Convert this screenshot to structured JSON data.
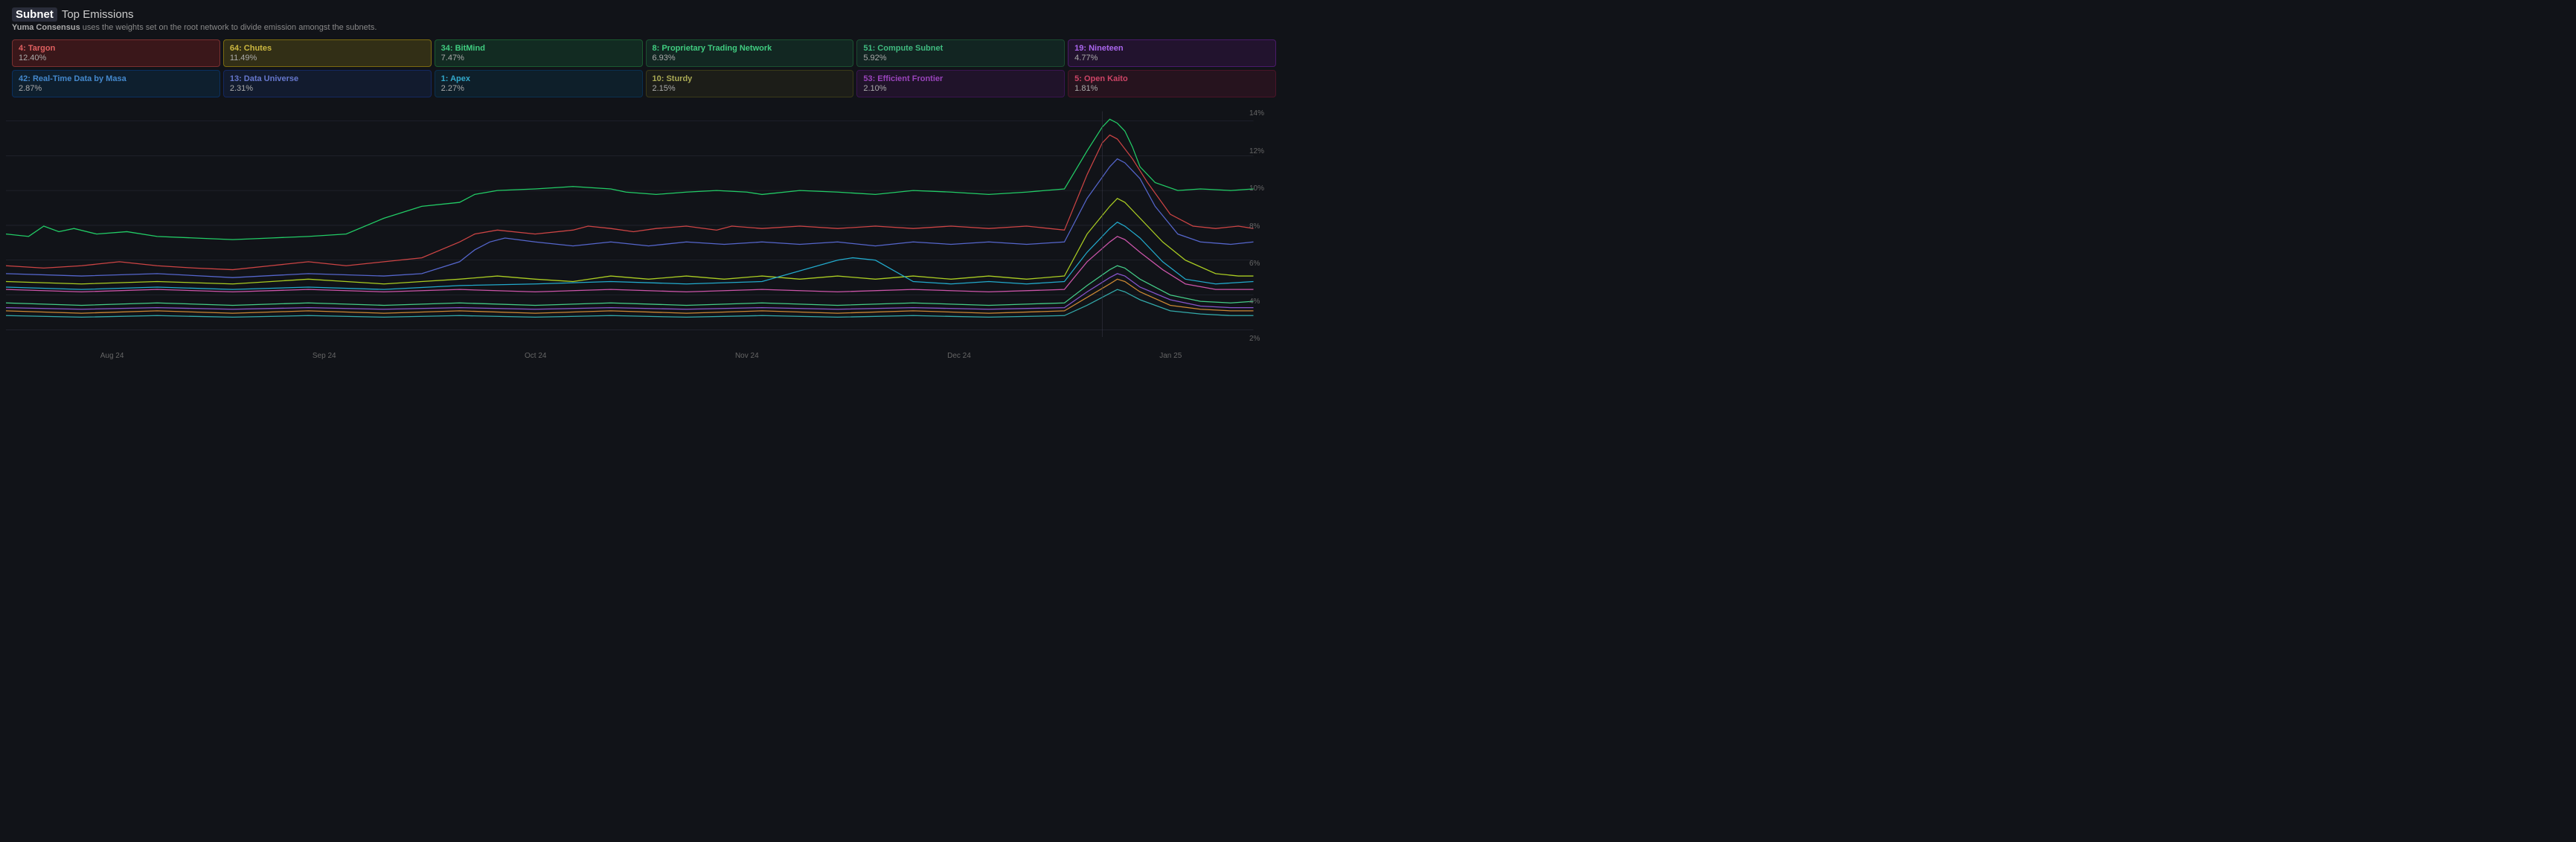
{
  "header": {
    "brand": "Subnet",
    "title": "Top Emissions",
    "subtitle_bold": "Yuma Consensus",
    "subtitle_rest": " uses the weights set on the root network to divide emission amongst the subnets."
  },
  "legend": [
    {
      "id": "4",
      "name": "Targon",
      "pct": "12.40%",
      "color": "#c84040",
      "border": "#7a2828"
    },
    {
      "id": "64",
      "name": "Chutes",
      "pct": "11.49%",
      "color": "#7a6a1a",
      "border": "#5a4e10"
    },
    {
      "id": "34",
      "name": "BitMind",
      "pct": "7.47%",
      "color": "#2a6a4a",
      "border": "#1a4a30"
    },
    {
      "id": "8",
      "name": "Proprietary Trading Network",
      "pct": "6.93%",
      "color": "#2a5a3a",
      "border": "#1a4028"
    },
    {
      "id": "51",
      "name": "Compute Subnet",
      "pct": "5.92%",
      "color": "#2a5040",
      "border": "#1a3830"
    },
    {
      "id": "19",
      "name": "Nineteen",
      "pct": "4.77%",
      "color": "#5a2a6a",
      "border": "#3a1a4a"
    },
    {
      "id": "42",
      "name": "Real-Time Data by Masa",
      "pct": "2.87%",
      "color": "#1a4a6a",
      "border": "#123050"
    },
    {
      "id": "13",
      "name": "Data Universe",
      "pct": "2.31%",
      "color": "#2a3a6a",
      "border": "#1a2850"
    },
    {
      "id": "1",
      "name": "Apex",
      "pct": "2.27%",
      "color": "#1a4a5a",
      "border": "#0e3040"
    },
    {
      "id": "10",
      "name": "Sturdy",
      "pct": "2.15%",
      "color": "#3a3a2a",
      "border": "#282818"
    },
    {
      "id": "53",
      "name": "Efficient Frontier",
      "pct": "2.10%",
      "color": "#4a2a5a",
      "border": "#301a3a"
    },
    {
      "id": "5",
      "name": "Open Kaito",
      "pct": "1.81%",
      "color": "#5a2a3a",
      "border": "#3a1a28"
    }
  ],
  "y_axis": [
    "14%",
    "12%",
    "10%",
    "8%",
    "6%",
    "4%",
    "2%"
  ],
  "x_axis": [
    "Aug 24",
    "Sep 24",
    "Oct 24",
    "Nov 24",
    "Dec 24",
    "Jan 25"
  ],
  "chart": {
    "accent_color": "#333"
  }
}
